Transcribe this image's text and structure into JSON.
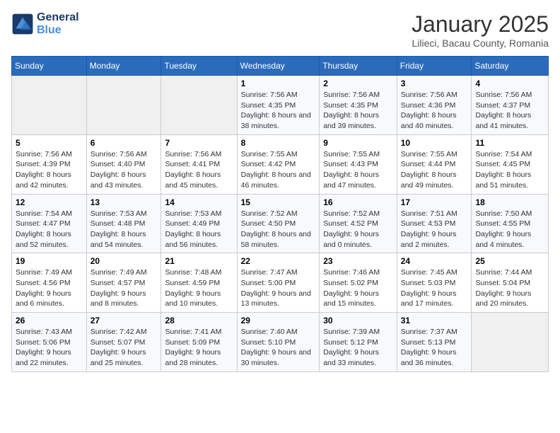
{
  "logo": {
    "line1": "General",
    "line2": "Blue"
  },
  "title": "January 2025",
  "subtitle": "Lilieci, Bacau County, Romania",
  "weekdays": [
    "Sunday",
    "Monday",
    "Tuesday",
    "Wednesday",
    "Thursday",
    "Friday",
    "Saturday"
  ],
  "weeks": [
    [
      null,
      null,
      null,
      {
        "day": 1,
        "sunrise": "7:56 AM",
        "sunset": "4:35 PM",
        "daylight": "8 hours and 38 minutes."
      },
      {
        "day": 2,
        "sunrise": "7:56 AM",
        "sunset": "4:35 PM",
        "daylight": "8 hours and 39 minutes."
      },
      {
        "day": 3,
        "sunrise": "7:56 AM",
        "sunset": "4:36 PM",
        "daylight": "8 hours and 40 minutes."
      },
      {
        "day": 4,
        "sunrise": "7:56 AM",
        "sunset": "4:37 PM",
        "daylight": "8 hours and 41 minutes."
      }
    ],
    [
      {
        "day": 5,
        "sunrise": "7:56 AM",
        "sunset": "4:39 PM",
        "daylight": "8 hours and 42 minutes."
      },
      {
        "day": 6,
        "sunrise": "7:56 AM",
        "sunset": "4:40 PM",
        "daylight": "8 hours and 43 minutes."
      },
      {
        "day": 7,
        "sunrise": "7:56 AM",
        "sunset": "4:41 PM",
        "daylight": "8 hours and 45 minutes."
      },
      {
        "day": 8,
        "sunrise": "7:55 AM",
        "sunset": "4:42 PM",
        "daylight": "8 hours and 46 minutes."
      },
      {
        "day": 9,
        "sunrise": "7:55 AM",
        "sunset": "4:43 PM",
        "daylight": "8 hours and 47 minutes."
      },
      {
        "day": 10,
        "sunrise": "7:55 AM",
        "sunset": "4:44 PM",
        "daylight": "8 hours and 49 minutes."
      },
      {
        "day": 11,
        "sunrise": "7:54 AM",
        "sunset": "4:45 PM",
        "daylight": "8 hours and 51 minutes."
      }
    ],
    [
      {
        "day": 12,
        "sunrise": "7:54 AM",
        "sunset": "4:47 PM",
        "daylight": "8 hours and 52 minutes."
      },
      {
        "day": 13,
        "sunrise": "7:53 AM",
        "sunset": "4:48 PM",
        "daylight": "8 hours and 54 minutes."
      },
      {
        "day": 14,
        "sunrise": "7:53 AM",
        "sunset": "4:49 PM",
        "daylight": "8 hours and 56 minutes."
      },
      {
        "day": 15,
        "sunrise": "7:52 AM",
        "sunset": "4:50 PM",
        "daylight": "8 hours and 58 minutes."
      },
      {
        "day": 16,
        "sunrise": "7:52 AM",
        "sunset": "4:52 PM",
        "daylight": "9 hours and 0 minutes."
      },
      {
        "day": 17,
        "sunrise": "7:51 AM",
        "sunset": "4:53 PM",
        "daylight": "9 hours and 2 minutes."
      },
      {
        "day": 18,
        "sunrise": "7:50 AM",
        "sunset": "4:55 PM",
        "daylight": "9 hours and 4 minutes."
      }
    ],
    [
      {
        "day": 19,
        "sunrise": "7:49 AM",
        "sunset": "4:56 PM",
        "daylight": "9 hours and 6 minutes."
      },
      {
        "day": 20,
        "sunrise": "7:49 AM",
        "sunset": "4:57 PM",
        "daylight": "9 hours and 8 minutes."
      },
      {
        "day": 21,
        "sunrise": "7:48 AM",
        "sunset": "4:59 PM",
        "daylight": "9 hours and 10 minutes."
      },
      {
        "day": 22,
        "sunrise": "7:47 AM",
        "sunset": "5:00 PM",
        "daylight": "9 hours and 13 minutes."
      },
      {
        "day": 23,
        "sunrise": "7:46 AM",
        "sunset": "5:02 PM",
        "daylight": "9 hours and 15 minutes."
      },
      {
        "day": 24,
        "sunrise": "7:45 AM",
        "sunset": "5:03 PM",
        "daylight": "9 hours and 17 minutes."
      },
      {
        "day": 25,
        "sunrise": "7:44 AM",
        "sunset": "5:04 PM",
        "daylight": "9 hours and 20 minutes."
      }
    ],
    [
      {
        "day": 26,
        "sunrise": "7:43 AM",
        "sunset": "5:06 PM",
        "daylight": "9 hours and 22 minutes."
      },
      {
        "day": 27,
        "sunrise": "7:42 AM",
        "sunset": "5:07 PM",
        "daylight": "9 hours and 25 minutes."
      },
      {
        "day": 28,
        "sunrise": "7:41 AM",
        "sunset": "5:09 PM",
        "daylight": "9 hours and 28 minutes."
      },
      {
        "day": 29,
        "sunrise": "7:40 AM",
        "sunset": "5:10 PM",
        "daylight": "9 hours and 30 minutes."
      },
      {
        "day": 30,
        "sunrise": "7:39 AM",
        "sunset": "5:12 PM",
        "daylight": "9 hours and 33 minutes."
      },
      {
        "day": 31,
        "sunrise": "7:37 AM",
        "sunset": "5:13 PM",
        "daylight": "9 hours and 36 minutes."
      },
      null
    ]
  ],
  "labels": {
    "sunrise": "Sunrise:",
    "sunset": "Sunset:",
    "daylight": "Daylight:"
  }
}
